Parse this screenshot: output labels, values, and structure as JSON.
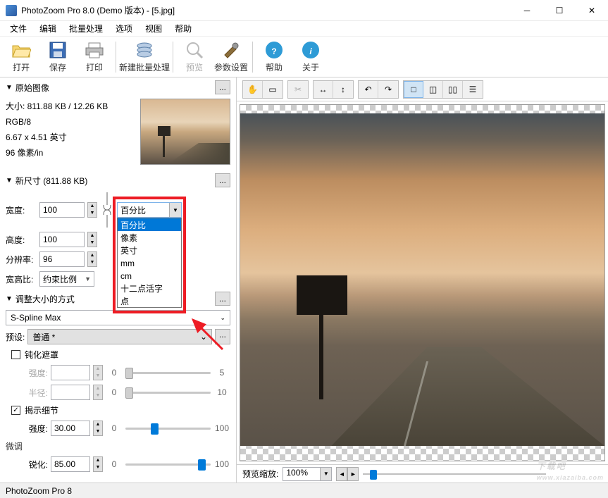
{
  "window": {
    "title": "PhotoZoom Pro 8.0 (Demo 版本) - [5.jpg]"
  },
  "menu": [
    "文件",
    "编辑",
    "批量处理",
    "选项",
    "视图",
    "帮助"
  ],
  "toolbar": {
    "open": "打开",
    "save": "保存",
    "print": "打印",
    "batch": "新建批量处理",
    "preview": "预览",
    "params": "参数设置",
    "help": "帮助",
    "about": "关于"
  },
  "orig": {
    "header": "原始图像",
    "size": "大小: 811.88 KB / 12.26 KB",
    "mode": "RGB/8",
    "dims": "6.67 x 4.51 英寸",
    "dpi": "96 像素/in"
  },
  "newsize": {
    "header": "新尺寸 (811.88 KB)",
    "width_lbl": "宽度:",
    "width_val": "100",
    "height_lbl": "高度:",
    "height_val": "100",
    "res_lbl": "分辨率:",
    "res_val": "96",
    "aspect_lbl": "宽高比:",
    "aspect_val": "约束比例",
    "unit_selected": "百分比",
    "unit_options": [
      "百分比",
      "像素",
      "英寸",
      "mm",
      "cm",
      "十二点活字",
      "点"
    ]
  },
  "method": {
    "header": "调整大小的方式",
    "algo": "S-Spline Max",
    "preset_lbl": "预设:",
    "preset_val": "普通 *",
    "unsharp_cb": "钝化遮罩",
    "intensity_lbl": "强度:",
    "intensity_val": "",
    "intensity_min": "0",
    "intensity_max": "5",
    "radius_lbl": "半径:",
    "radius_val": "",
    "radius_min": "0",
    "radius_max": "10",
    "detail_cb": "揭示细节",
    "detail_int_lbl": "强度:",
    "detail_int_val": "30.00",
    "detail_int_min": "0",
    "detail_int_max": "100",
    "fine_lbl": "微调",
    "sharp_lbl": "锐化:",
    "sharp_val": "85.00",
    "sharp_min": "0",
    "sharp_max": "100"
  },
  "preview": {
    "zoom_lbl": "预览缩放:",
    "zoom_val": "100%"
  },
  "status": {
    "text": "PhotoZoom Pro 8"
  },
  "watermark": {
    "main": "下载吧",
    "sub": "www.xiazaiba.com"
  }
}
